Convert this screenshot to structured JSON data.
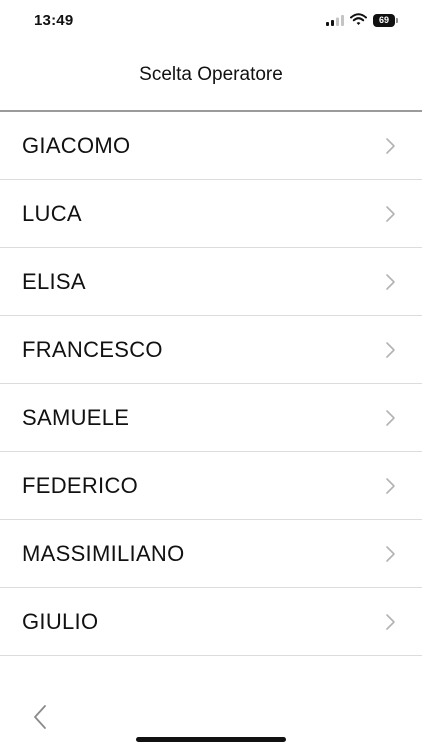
{
  "status_bar": {
    "time": "13:49",
    "battery_level": "69",
    "icons": [
      "signal-icon",
      "wifi-icon",
      "battery-icon"
    ]
  },
  "header": {
    "title": "Scelta Operatore"
  },
  "operators": [
    {
      "name": "GIACOMO"
    },
    {
      "name": "LUCA"
    },
    {
      "name": "ELISA"
    },
    {
      "name": "FRANCESCO"
    },
    {
      "name": "SAMUELE"
    },
    {
      "name": "FEDERICO"
    },
    {
      "name": "MASSIMILIANO"
    },
    {
      "name": "GIULIO"
    }
  ],
  "toolbar": {
    "back_icon": "chevron-left-icon"
  },
  "colors": {
    "text": "#111111",
    "divider": "#dcdcdc",
    "header_divider": "#9b9b9b",
    "chevron": "#b3b3b3"
  }
}
